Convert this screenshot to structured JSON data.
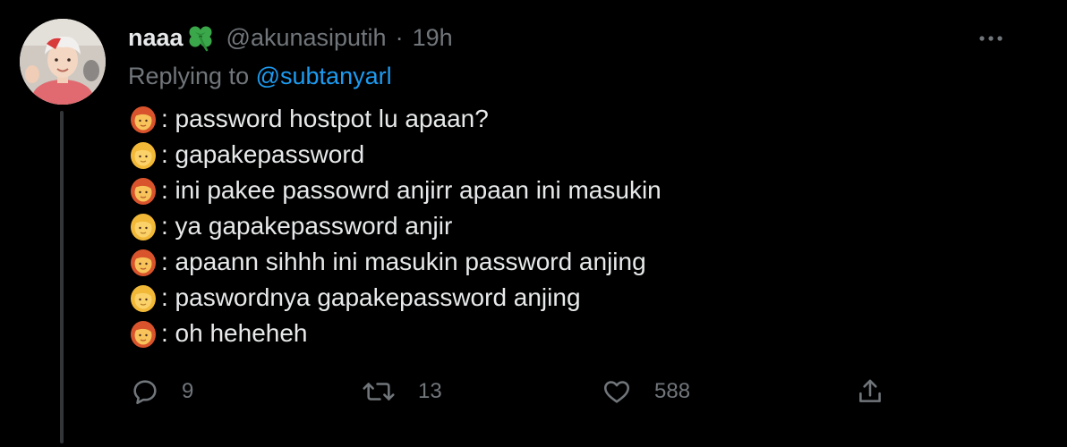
{
  "tweet": {
    "display_name": "naaa",
    "name_emoji": "four-leaf-clover",
    "handle": "@akunasiputih",
    "separator": "·",
    "time": "19h",
    "replying_prefix": "Replying to",
    "replying_to": "@subtanyarl",
    "lines": [
      {
        "speaker": "red-haired-woman-emoji",
        "text": ": password hostpot lu apaan?"
      },
      {
        "speaker": "blond-woman-emoji",
        "text": ": gapakepassword"
      },
      {
        "speaker": "red-haired-woman-emoji",
        "text": ": ini pakee passowrd anjirr apaan ini masukin"
      },
      {
        "speaker": "blond-woman-emoji",
        "text": ": ya gapakepassword anjir"
      },
      {
        "speaker": "red-haired-woman-emoji",
        "text": ": apaann sihhh ini masukin password anjing"
      },
      {
        "speaker": "blond-woman-emoji",
        "text": ": paswordnya gapakepassword anjing"
      },
      {
        "speaker": "red-haired-woman-emoji",
        "text": ": oh heheheh"
      }
    ]
  },
  "actions": {
    "reply_count": "9",
    "retweet_count": "13",
    "like_count": "588"
  },
  "colors": {
    "background": "#000000",
    "text": "#e7e9ea",
    "muted": "#71767b",
    "link": "#1d9bf0",
    "thread_line": "#333639"
  }
}
